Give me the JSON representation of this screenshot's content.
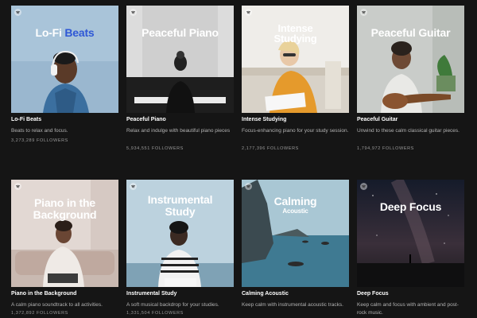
{
  "playlists": [
    {
      "cover_title_main": "Lo-Fi",
      "cover_title_accent": "Beats",
      "name": "Lo-Fi Beats",
      "description": "Beats to relax and focus.",
      "followers": "3,273,289 FOLLOWERS"
    },
    {
      "cover_title": "Peaceful Piano",
      "name": "Peaceful Piano",
      "description": "Relax and indulge with beautiful piano pieces",
      "followers": "5,934,551 FOLLOWERS"
    },
    {
      "cover_title_line1": "Intense",
      "cover_title_line2": "Studying",
      "name": "Intense Studying",
      "description": "Focus-enhancing piano for your study session.",
      "followers": "2,177,396 FOLLOWERS"
    },
    {
      "cover_title": "Peaceful Guitar",
      "name": "Peaceful Guitar",
      "description": "Unwind to these calm classical guitar pieces.",
      "followers": "1,794,972 FOLLOWERS"
    },
    {
      "cover_title_line1": "Piano in the",
      "cover_title_line2": "Background",
      "name": "Piano in the Background",
      "description": "A calm piano soundtrack to all activities.",
      "followers": "1,372,892 FOLLOWERS"
    },
    {
      "cover_title_line1": "Instrumental",
      "cover_title_line2": "Study",
      "name": "Instrumental Study",
      "description": "A soft musical backdrop for your studies.",
      "followers": "1,331,504 FOLLOWERS"
    },
    {
      "cover_title_line1": "Calming",
      "cover_title_line2": "Acoustic",
      "name": "Calming Acoustic",
      "description": "Keep calm with instrumental acoustic tracks.",
      "followers": ""
    },
    {
      "cover_title": "Deep Focus",
      "name": "Deep Focus",
      "description": "Keep calm and focus with ambient and post-rock music.",
      "followers": ""
    }
  ],
  "colors": {
    "background": "#151515",
    "accent_title": "#2f58d6",
    "muted_text": "#b3b3b3"
  },
  "icons": [
    "spotify-logo-icon"
  ]
}
